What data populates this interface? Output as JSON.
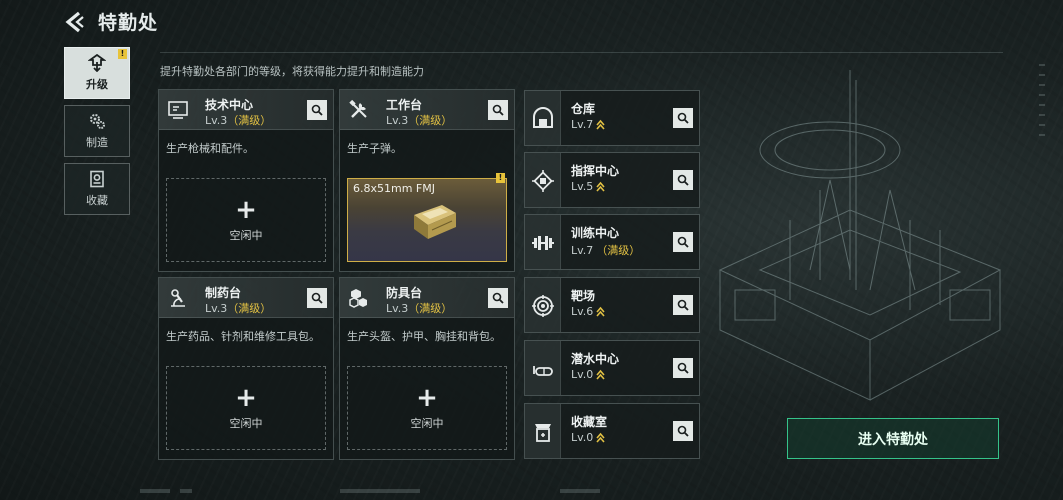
{
  "header": {
    "title": "特勤处"
  },
  "subtitle": "提升特勤处各部门的等级，将获得能力提升和制造能力",
  "nav": {
    "items": [
      {
        "label": "升级",
        "icon": "upgrade-icon",
        "active": true,
        "badge": "!"
      },
      {
        "label": "制造",
        "icon": "gears-icon",
        "active": false
      },
      {
        "label": "收藏",
        "icon": "collection-icon",
        "active": false
      }
    ]
  },
  "cards": {
    "tech": {
      "title": "技术中心",
      "level": "Lv.3",
      "max": "（满级）",
      "desc": "生产枪械和配件。",
      "slot": "空闲中"
    },
    "workbench": {
      "title": "工作台",
      "level": "Lv.3",
      "max": "（满级）",
      "desc": "生产子弹。",
      "craft_item": "6.8x51mm FMJ",
      "badge": "!"
    },
    "pharmacy": {
      "title": "制药台",
      "level": "Lv.3",
      "max": "（满级）",
      "desc": "生产药品、针剂和维修工具包。",
      "slot": "空闲中"
    },
    "armor": {
      "title": "防具台",
      "level": "Lv.3",
      "max": "（满级）",
      "desc": "生产头盔、护甲、胸挂和背包。",
      "slot": "空闲中"
    }
  },
  "facilities": [
    {
      "title": "仓库",
      "level": "Lv.7",
      "max": "",
      "upgradable": true,
      "icon": "warehouse-icon"
    },
    {
      "title": "指挥中心",
      "level": "Lv.5",
      "max": "",
      "upgradable": true,
      "icon": "command-chip-icon"
    },
    {
      "title": "训练中心",
      "level": "Lv.7",
      "max": "（满级）",
      "upgradable": false,
      "icon": "dumbbell-icon"
    },
    {
      "title": "靶场",
      "level": "Lv.6",
      "max": "",
      "upgradable": true,
      "icon": "target-icon"
    },
    {
      "title": "潜水中心",
      "level": "Lv.0",
      "max": "",
      "upgradable": true,
      "icon": "diving-mask-icon"
    },
    {
      "title": "收藏室",
      "level": "Lv.0",
      "max": "",
      "upgradable": true,
      "icon": "collection-room-icon"
    }
  ],
  "enter_button": "进入特勤处",
  "colors": {
    "accent_gold": "#e1c043",
    "accent_green": "#35c38a",
    "panel": "#121818"
  }
}
